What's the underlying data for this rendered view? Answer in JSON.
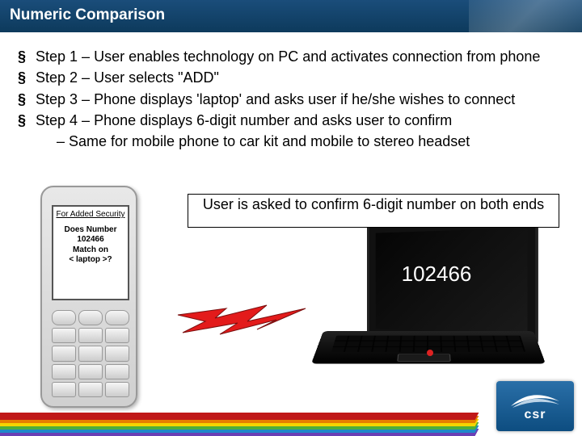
{
  "header": {
    "title": "Numeric Comparison"
  },
  "bullets": {
    "items": [
      "Step 1 – User enables technology on PC and activates connection from phone",
      "Step 2 – User selects \"ADD\"",
      "Step 3 – Phone displays 'laptop' and asks user if he/she wishes to connect",
      "Step 4 – Phone displays 6-digit number and asks user to confirm"
    ],
    "subitems": [
      "Same for mobile phone to car kit and mobile to stereo headset"
    ]
  },
  "callout": {
    "text": "User is asked to confirm 6-digit number on both ends"
  },
  "phone": {
    "line1": "For Added Security",
    "line2": "Does Number",
    "line3": "102466",
    "line4": "Match on",
    "line5": "< laptop >?"
  },
  "laptop": {
    "number": "102466"
  },
  "logo": {
    "text": "csr"
  },
  "colors": {
    "rainbow": [
      "#c01818",
      "#e67e00",
      "#f5d400",
      "#4fae3a",
      "#1e88c9",
      "#6a3fb5"
    ]
  }
}
